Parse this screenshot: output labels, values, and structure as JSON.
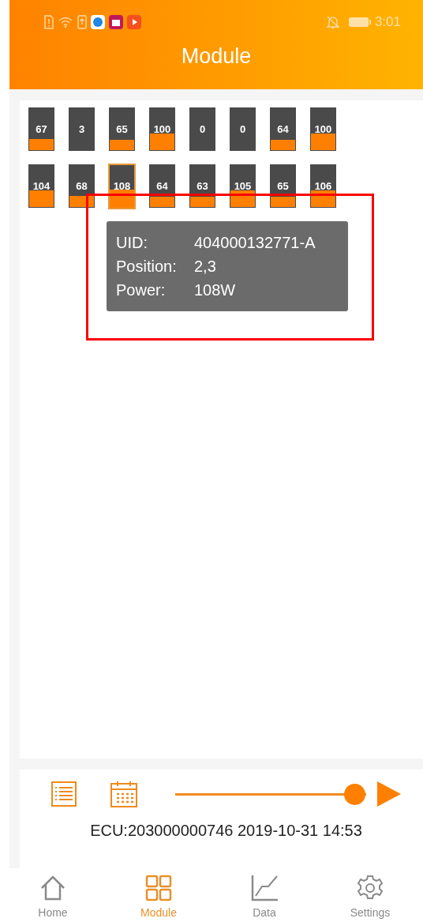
{
  "status_bar": {
    "time": "3:01"
  },
  "header": {
    "title": "Module"
  },
  "module_rows": [
    [
      {
        "value": "67",
        "level": 0.26,
        "selected": false
      },
      {
        "value": "3",
        "selected": false
      },
      {
        "value": "65",
        "level": 0.24,
        "selected": false
      },
      {
        "value": "100",
        "level": 0.39,
        "selected": false
      },
      {
        "value": "0",
        "selected": false
      },
      {
        "value": "0",
        "selected": false
      },
      {
        "value": "64",
        "level": 0.24,
        "selected": false
      },
      {
        "value": "100",
        "level": 0.39,
        "selected": false
      }
    ],
    [
      {
        "value": "104",
        "level": 0.4,
        "selected": false
      },
      {
        "value": "68",
        "level": 0.26,
        "selected": false
      },
      {
        "value": "108",
        "level": 0.42,
        "selected": true
      },
      {
        "value": "64",
        "level": 0.24,
        "selected": false
      },
      {
        "value": "63",
        "level": 0.24,
        "selected": false
      },
      {
        "value": "105",
        "level": 0.4,
        "selected": false
      },
      {
        "value": "65",
        "level": 0.25,
        "selected": false
      },
      {
        "value": "106",
        "level": 0.4,
        "selected": false
      }
    ]
  ],
  "tooltip": {
    "rows": [
      {
        "label": "UID:",
        "value": "404000132771-A"
      },
      {
        "label": "Position:",
        "value": "2,3"
      },
      {
        "label": "Power:",
        "value": "108W"
      }
    ]
  },
  "player": {
    "level": 0.94,
    "caption": "ECU:203000000746 2019-10-31 14:53"
  },
  "nav": [
    {
      "label": "Home",
      "selected": false
    },
    {
      "label": "Module",
      "selected": true
    },
    {
      "label": "Data",
      "selected": false
    },
    {
      "label": "Settings",
      "selected": false
    }
  ]
}
